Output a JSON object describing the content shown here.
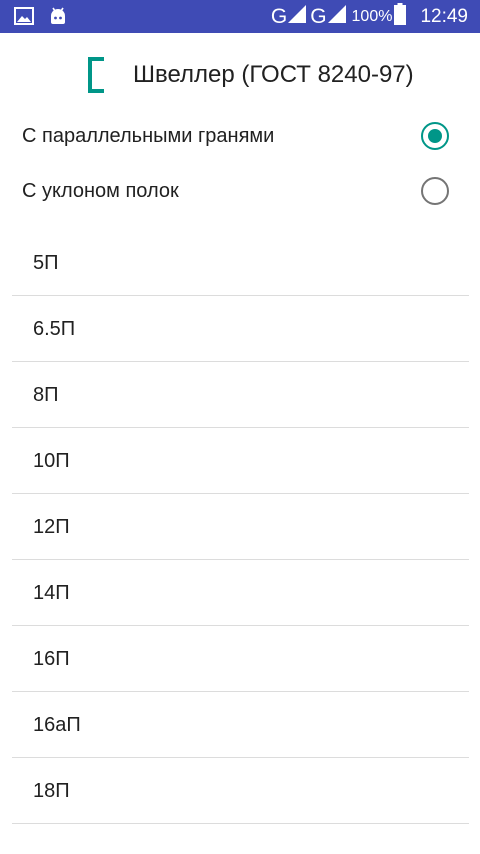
{
  "status_bar": {
    "network_1": "G",
    "network_2": "G",
    "battery_level": "100%",
    "time": "12:49",
    "left_icons": [
      "gallery-icon",
      "android-icon"
    ]
  },
  "header": {
    "title": "Швеллер (ГОСТ 8240-97)",
    "icon": "channel-section-icon",
    "accent_color": "#009688"
  },
  "radio_options": [
    {
      "label": "С параллельными гранями",
      "checked": true
    },
    {
      "label": "С уклоном полок",
      "checked": false
    }
  ],
  "list": {
    "items": [
      "5П",
      "6.5П",
      "8П",
      "10П",
      "12П",
      "14П",
      "16П",
      "16аП",
      "18П"
    ]
  },
  "colors": {
    "status_bar": "#3f4bb5",
    "accent": "#009688",
    "text": "#212121",
    "divider": "#dcdcdc"
  }
}
